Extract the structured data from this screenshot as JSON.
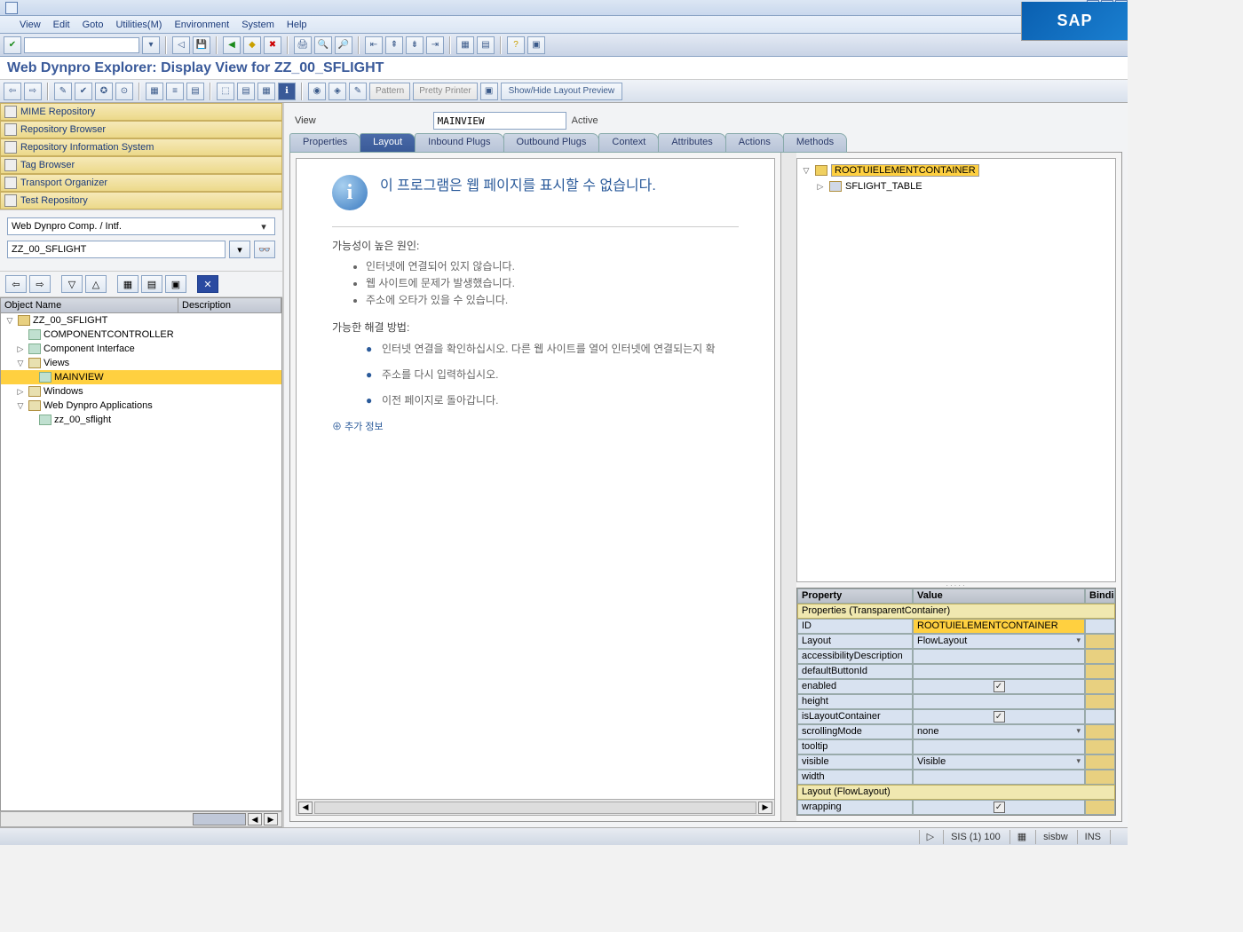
{
  "menu": {
    "view": "View",
    "edit": "Edit",
    "goto": "Goto",
    "utilities": "Utilities(M)",
    "environment": "Environment",
    "system": "System",
    "help": "Help"
  },
  "sap_logo": "SAP",
  "page_title": "Web Dynpro Explorer: Display View for ZZ_00_SFLIGHT",
  "tb2": {
    "pattern": "Pattern",
    "pretty": "Pretty Printer",
    "showhide": "Show/Hide Layout Preview"
  },
  "left_nav": [
    "MIME Repository",
    "Repository Browser",
    "Repository Information System",
    "Tag Browser",
    "Transport Organizer",
    "Test Repository"
  ],
  "left": {
    "combo": "Web Dynpro Comp. / Intf.",
    "object": "ZZ_00_SFLIGHT",
    "tree_hdr_name": "Object Name",
    "tree_hdr_desc": "Description"
  },
  "tree": {
    "root": "ZZ_00_SFLIGHT",
    "n1": "COMPONENTCONTROLLER",
    "n2": "Component Interface",
    "n3": "Views",
    "n3a": "MAINVIEW",
    "n4": "Windows",
    "n5": "Web Dynpro Applications",
    "n5a": "zz_00_sflight"
  },
  "right": {
    "view_label": "View",
    "view_value": "MAINVIEW",
    "status": "Active"
  },
  "tabs": [
    "Properties",
    "Layout",
    "Inbound Plugs",
    "Outbound Plugs",
    "Context",
    "Attributes",
    "Actions",
    "Methods"
  ],
  "preview": {
    "title": "이 프로그램은 웹 페이지를 표시할 수 없습니다.",
    "cause_hdr": "가능성이 높은 원인:",
    "causes": [
      "인터넷에 연결되어 있지 않습니다.",
      "웹 사이트에 문제가 발생했습니다.",
      "주소에 오타가 있을 수 있습니다."
    ],
    "try_hdr": "가능한 해결 방법:",
    "tries": [
      "인터넷 연결을 확인하십시오. 다른 웹 사이트를 열어 인터넷에 연결되는지 확",
      "주소를 다시 입력하십시오.",
      "이전 페이지로 돌아갑니다."
    ],
    "more": "추가 정보"
  },
  "elem_tree": {
    "root": "ROOTUIELEMENTCONTAINER",
    "child": "SFLIGHT_TABLE"
  },
  "props": {
    "hdr_prop": "Property",
    "hdr_val": "Value",
    "hdr_bind": "Bindi",
    "section1": "Properties (TransparentContainer)",
    "rows": [
      {
        "p": "ID",
        "v": "ROOTUIELEMENTCONTAINER",
        "sel": true
      },
      {
        "p": "Layout",
        "v": "FlowLayout",
        "dd": true,
        "bind": true
      },
      {
        "p": "accessibilityDescription",
        "v": "",
        "bind": true
      },
      {
        "p": "defaultButtonId",
        "v": "",
        "bind": true
      },
      {
        "p": "enabled",
        "v": "",
        "chk": true,
        "bind": true
      },
      {
        "p": "height",
        "v": "",
        "bind": true
      },
      {
        "p": "isLayoutContainer",
        "v": "",
        "chk": true
      },
      {
        "p": "scrollingMode",
        "v": "none",
        "dd": true,
        "bind": true
      },
      {
        "p": "tooltip",
        "v": "",
        "bind": true
      },
      {
        "p": "visible",
        "v": "Visible",
        "dd": true,
        "bind": true
      },
      {
        "p": "width",
        "v": "",
        "bind": true
      }
    ],
    "section2": "Layout (FlowLayout)",
    "rows2": [
      {
        "p": "wrapping",
        "v": "",
        "chk": true,
        "bind": true
      }
    ]
  },
  "status": {
    "sis": "SIS (1) 100",
    "srv": "sisbw",
    "ins": "INS"
  }
}
